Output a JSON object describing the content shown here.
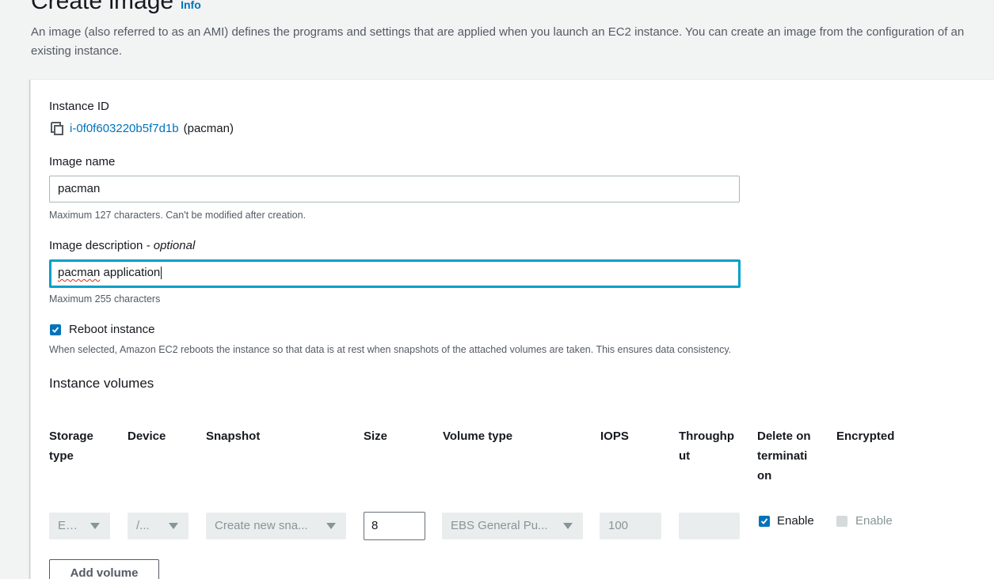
{
  "header": {
    "title": "Create image",
    "info_link": "Info",
    "description": "An image (also referred to as an AMI) defines the programs and settings that are applied when you launch an EC2 instance. You can create an image from the configuration of an existing instance."
  },
  "form": {
    "instance_id": {
      "label": "Instance ID",
      "id": "i-0f0f603220b5f7d1b",
      "name": "(pacman)",
      "icon": "copy-icon"
    },
    "image_name": {
      "label": "Image name",
      "value": "pacman",
      "hint": "Maximum 127 characters. Can't be modified after creation."
    },
    "image_description": {
      "label": "Image description",
      "label_optional": "- optional",
      "value_misspelled": "pacman",
      "value_rest": " application",
      "hint": "Maximum 255 characters"
    },
    "reboot": {
      "label": "Reboot instance",
      "checked": true,
      "hint": "When selected, Amazon EC2 reboots the instance so that data is at rest when snapshots of the attached volumes are taken. This ensures data consistency."
    }
  },
  "volumes": {
    "title": "Instance volumes",
    "columns": {
      "storage_type": [
        "Storage",
        "type"
      ],
      "device": [
        "Device"
      ],
      "snapshot": [
        "Snapshot"
      ],
      "size": [
        "Size"
      ],
      "volume_type": [
        "Volume type"
      ],
      "iops": [
        "IOPS"
      ],
      "throughput": [
        "Throughp",
        "ut"
      ],
      "delete_on_termination": [
        "Delete on",
        "terminati",
        "on"
      ],
      "encrypted": [
        "Encrypted"
      ]
    },
    "row": {
      "storage_type": "EBS",
      "device": "/...",
      "snapshot": "Create new sna...",
      "size": "8",
      "volume_type": "EBS General Pu...",
      "iops": "100",
      "throughput": "",
      "delete_on_termination": {
        "label": "Enable",
        "checked": true
      },
      "encrypted": {
        "label": "Enable",
        "checked": false,
        "disabled": true
      }
    },
    "add_volume_label": "Add volume"
  },
  "colors": {
    "link": "#0073bb",
    "focus": "#00a1c9",
    "checkbox": "#0073bb",
    "background": "#f2f3f3"
  }
}
